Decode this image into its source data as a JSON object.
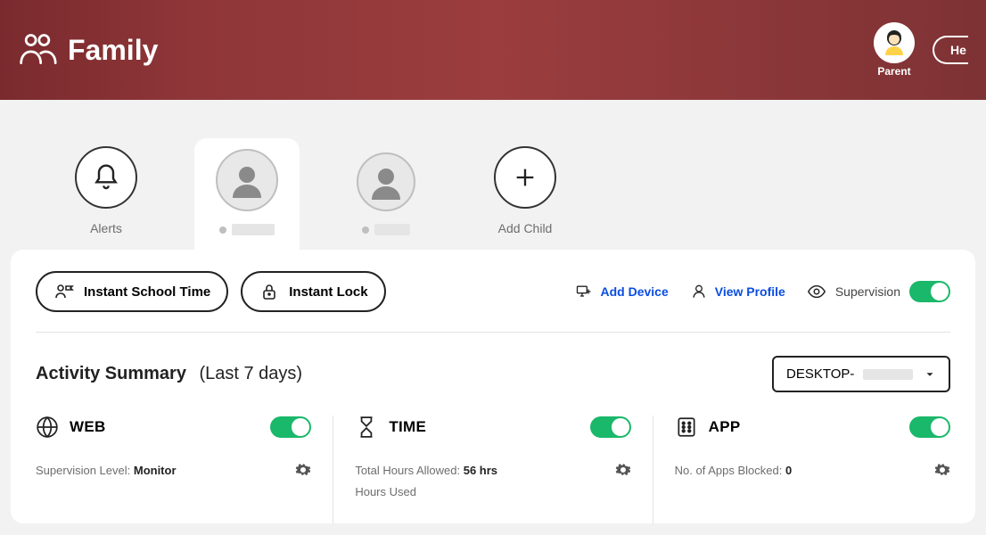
{
  "header": {
    "title": "Family",
    "parentLabel": "Parent",
    "helpLabel": "He"
  },
  "tabs": {
    "alerts": "Alerts",
    "addChild": "Add Child"
  },
  "actions": {
    "instantSchool": "Instant School Time",
    "instantLock": "Instant Lock",
    "addDevice": "Add Device",
    "viewProfile": "View Profile",
    "supervision": "Supervision"
  },
  "summary": {
    "title": "Activity Summary",
    "range": "(Last 7 days)",
    "devicePrefix": "DESKTOP-"
  },
  "panels": {
    "web": {
      "title": "WEB",
      "label": "Supervision Level:",
      "value": "Monitor"
    },
    "time": {
      "title": "TIME",
      "allowedLabel": "Total Hours Allowed:",
      "allowedValue": "56 hrs",
      "usedLabel": "Hours Used"
    },
    "app": {
      "title": "APP",
      "blockedLabel": "No. of Apps Blocked:",
      "blockedValue": "0"
    }
  }
}
